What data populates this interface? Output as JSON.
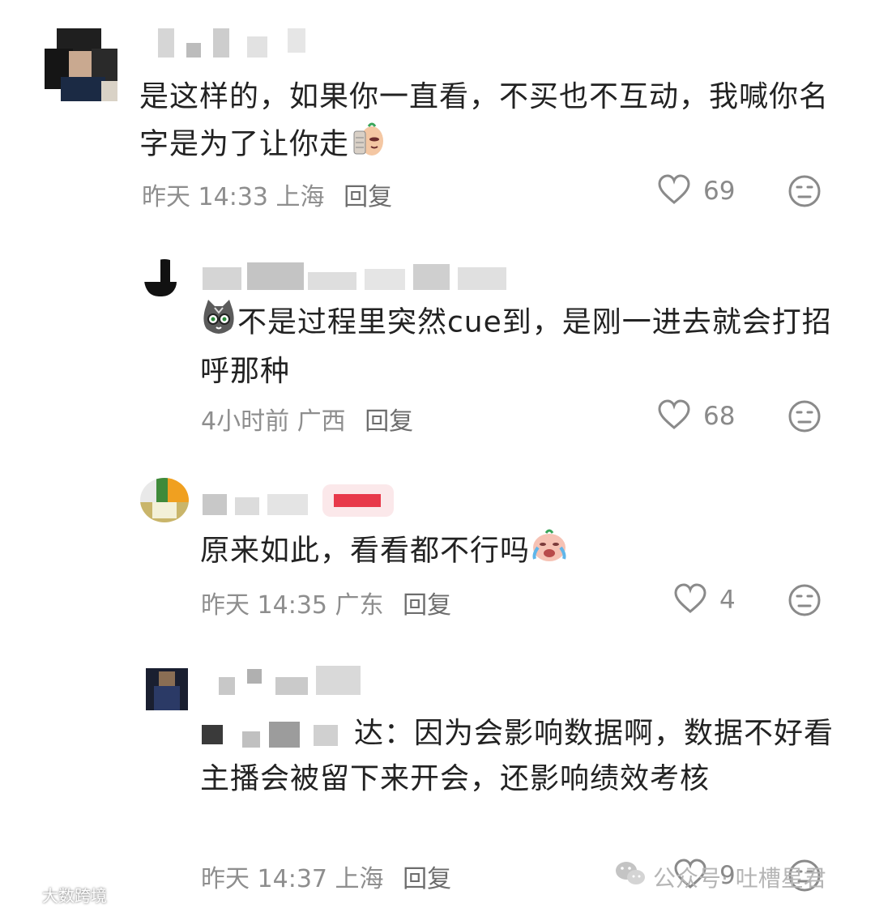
{
  "comments": [
    {
      "text": "是这样的，如果你一直看，不买也不互动，我喊你名字是为了让你走",
      "time": "昨天 14:33",
      "location": "上海",
      "reply_label": "回复",
      "likes": "69"
    },
    {
      "text": "不是过程里突然cue到，是刚一进去就会打招呼那种",
      "time": "4小时前",
      "location": "广西",
      "reply_label": "回复",
      "likes": "68"
    },
    {
      "text": "原来如此，看看都不行吗",
      "time": "昨天 14:35",
      "location": "广东",
      "reply_label": "回复",
      "likes": "4"
    },
    {
      "quote_suffix": "达：",
      "text": "因为会影响数据啊，数据不好看主播会被留下来开会，还影响绩效考核",
      "time": "昨天 14:37",
      "location": "上海",
      "reply_label": "回复",
      "likes": "9"
    }
  ],
  "watermark": {
    "account": "公众号· 吐槽星君",
    "logo_text": "大数跨境"
  },
  "colors": {
    "meta_gray": "#8e8e8e",
    "text": "#222222",
    "badge_red": "#e8394a"
  }
}
